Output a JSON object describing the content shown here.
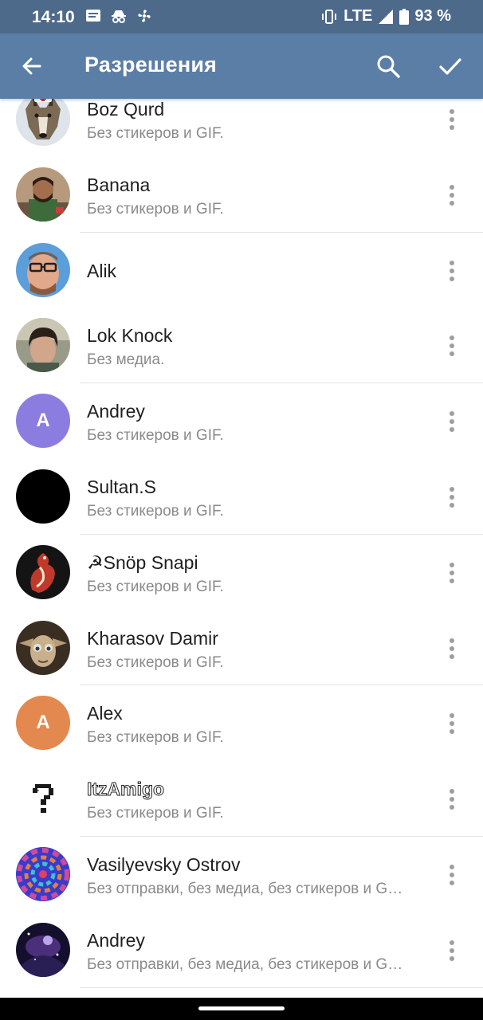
{
  "status_bar": {
    "time": "14:10",
    "network": "LTE",
    "battery": "93 %",
    "icons": [
      "message-icon",
      "incognito-icon",
      "fan-icon",
      "vibrate-icon",
      "signal-icon",
      "battery-icon"
    ]
  },
  "app_bar": {
    "title": "Разрешения",
    "icons": [
      "back-arrow-icon",
      "search-icon",
      "checkmark-icon"
    ],
    "color": "#5b7ea6"
  },
  "members": [
    {
      "name": "Boz Qurd",
      "status": "Без стикеров и GIF.",
      "avatar": "wolf-photo"
    },
    {
      "name": "Banana",
      "status": "Без стикеров и GIF.",
      "avatar": "person-photo"
    },
    {
      "name": "Alik",
      "status": "",
      "avatar": "person-photo"
    },
    {
      "name": "Lok Knock",
      "status": "Без медиа.",
      "avatar": "person-photo"
    },
    {
      "name": "Andrey",
      "status": "Без стикеров и GIF.",
      "avatar": "letter",
      "avatar_letter": "A",
      "avatar_color": "#8b7de0"
    },
    {
      "name": "Sultan.S",
      "status": "Без стикеров и GIF.",
      "avatar": "black-circle"
    },
    {
      "name": "☭Snöp Snapi",
      "status": "Без стикеров и GIF.",
      "avatar": "dragon-photo"
    },
    {
      "name": "Kharasov Damir",
      "status": "Без стикеров и GIF.",
      "avatar": "creature-photo"
    },
    {
      "name": "Alex",
      "status": "Без стикеров и GIF.",
      "avatar": "letter",
      "avatar_letter": "A",
      "avatar_color": "#e3894f"
    },
    {
      "name": "ItzAmigo",
      "status": "Без стикеров и GIF.",
      "avatar": "question-mark-picture"
    },
    {
      "name": "Vasilyevsky Ostrov",
      "status": "Без отправки, без медиа, без стикеров и G…",
      "avatar": "spiral-pattern"
    },
    {
      "name": "Andrey",
      "status": "Без отправки, без медиа, без стикеров и G…",
      "avatar": "space-art"
    }
  ]
}
